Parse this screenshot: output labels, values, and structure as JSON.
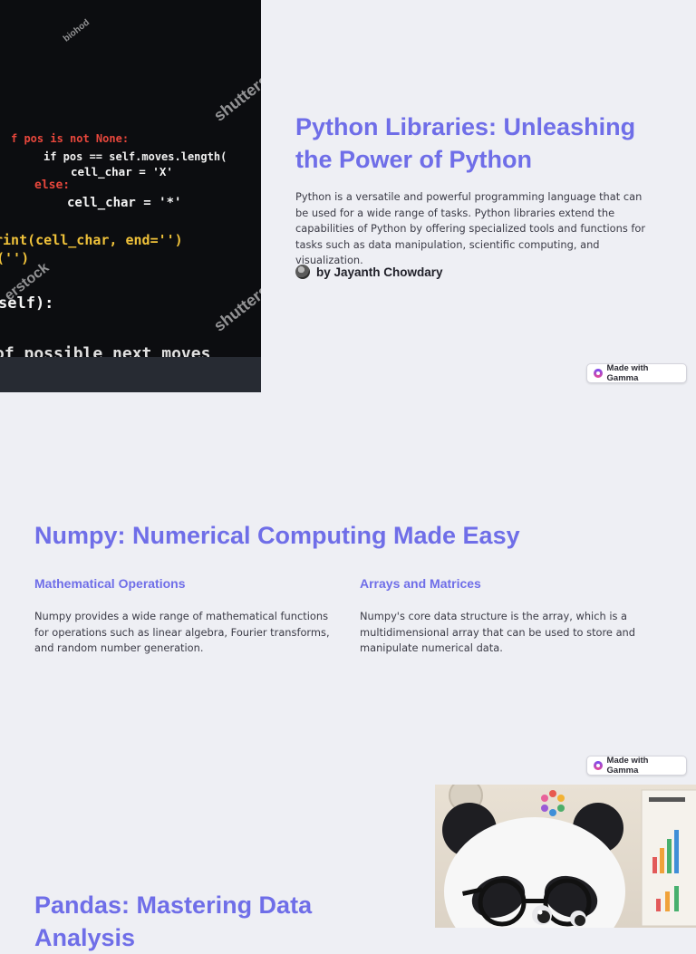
{
  "slide1": {
    "title": "Python Libraries: Unleashing the Power of Python",
    "description": "Python is a versatile and powerful programming language that can be used for a wide range of tasks. Python libraries extend the capabilities of Python by offering specialized tools and functions for tasks such as data manipulation, scientific computing, and visualization.",
    "author": "by Jayanth Chowdary",
    "image": {
      "code_lines": [
        "f pos is not None:",
        "if pos == self.moves.length(",
        "cell_char = 'X'",
        "else:",
        "cell_char = '*'",
        "rint(cell_char, end='')",
        "('')",
        "self):",
        "of possible next moves"
      ],
      "watermarks": [
        "shutterstock",
        "biohod",
        "shutterst",
        "erstock"
      ]
    },
    "badge": "Made with Gamma"
  },
  "slide2": {
    "title": "Numpy: Numerical Computing Made Easy",
    "columns": [
      {
        "heading": "Mathematical Operations",
        "text": "Numpy provides a wide range of mathematical functions for operations such as linear algebra, Fourier transforms, and random number generation."
      },
      {
        "heading": "Arrays and Matrices",
        "text": "Numpy's core data structure is the array, which is a multidimensional array that can be used to store and manipulate numerical data."
      }
    ],
    "badge": "Made with Gamma"
  },
  "slide3": {
    "title": "Pandas: Mastering Data Analysis"
  },
  "colors": {
    "background": "#eeeff4",
    "accent": "#6f6ee8",
    "body_text": "#3b3b46"
  }
}
